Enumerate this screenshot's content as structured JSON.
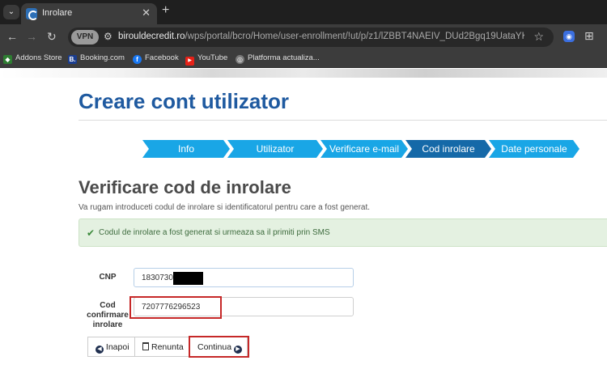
{
  "browser": {
    "tab_title": "Inrolare",
    "tab_close": "✕",
    "new_tab": "+",
    "menu_glyph": "⌄",
    "nav_back": "←",
    "nav_forward": "→",
    "nav_reload": "↻",
    "vpn_badge": "VPN",
    "url_host": "birouldecredit.ro",
    "url_path": "/wps/portal/bcro/Home/user-enrollment/!ut/p/z1/lZBBT4NAEIV_DUd2Bgq19UataYKKqaYp7MU...",
    "star_glyph": "☆",
    "puzzle_glyph": "⊞",
    "shield_glyph": "◉",
    "bookmarks": [
      {
        "label": "Addons Store",
        "icon": "addons-store-icon",
        "color": "#2e7d32",
        "glyph": "◆"
      },
      {
        "label": "Booking.com",
        "icon": "booking-icon",
        "color": "#1a3d8f",
        "glyph": "B."
      },
      {
        "label": "Facebook",
        "icon": "facebook-icon",
        "color": "#1877f2",
        "glyph": "f"
      },
      {
        "label": "YouTube",
        "icon": "youtube-icon",
        "color": "#e62117",
        "glyph": "▶"
      },
      {
        "label": "Platforma actualiza...",
        "icon": "globe-icon",
        "color": "#7a7a7a",
        "glyph": "◎"
      }
    ]
  },
  "page": {
    "title": "Creare cont utilizator",
    "steps": [
      {
        "label": "Info",
        "active": false
      },
      {
        "label": "Utilizator",
        "active": false
      },
      {
        "label": "Verificare e-mail",
        "active": false
      },
      {
        "label": "Cod inrolare",
        "active": true
      },
      {
        "label": "Date personale",
        "active": false
      }
    ],
    "step_color": "#19a6e6",
    "step_active_color": "#1569a8",
    "section_title": "Verificare cod de inrolare",
    "section_desc": "Va rugam introduceti codul de inrolare si identificatorul pentru care a fost generat.",
    "alert_text": "Codul de inrolare a fost generat si urmeaza sa il primiti prin SMS",
    "alert_icon": "✔"
  },
  "form": {
    "cnp_label": "CNP",
    "cnp_value": "1830730",
    "code_label": "Cod confirmare inrolare",
    "code_value": "7207776296523"
  },
  "buttons": {
    "back_label": "Inapoi",
    "back_icon": "◀",
    "cancel_label": "Renunta",
    "continue_label": "Continua",
    "continue_icon": "▶"
  }
}
